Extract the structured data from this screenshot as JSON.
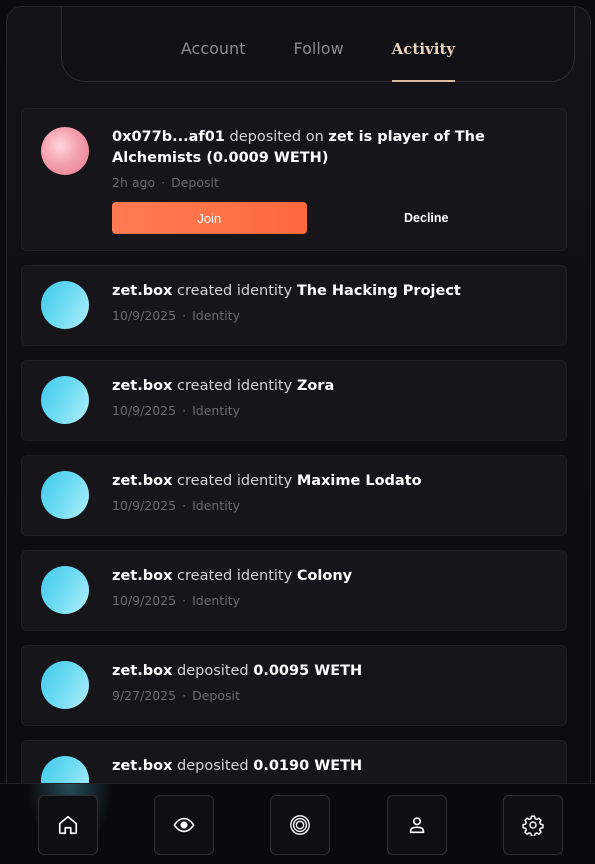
{
  "tabs": [
    {
      "label": "Account"
    },
    {
      "label": "Follow"
    },
    {
      "label": "Activity"
    }
  ],
  "feed": [
    {
      "actor": "0x077b...af01",
      "verb": "deposited on",
      "target": "zet is player of The Alchemists (0.0009 WETH)",
      "time": "2h ago",
      "kind": "Deposit",
      "join_label": "Join",
      "decline_label": "Decline"
    },
    {
      "actor": "zet.box",
      "verb": "created identity",
      "target": "The Hacking Project",
      "time": "10/9/2025",
      "kind": "Identity"
    },
    {
      "actor": "zet.box",
      "verb": "created identity",
      "target": "Zora",
      "time": "10/9/2025",
      "kind": "Identity"
    },
    {
      "actor": "zet.box",
      "verb": "created identity",
      "target": "Maxime Lodato",
      "time": "10/9/2025",
      "kind": "Identity"
    },
    {
      "actor": "zet.box",
      "verb": "created identity",
      "target": "Colony",
      "time": "10/9/2025",
      "kind": "Identity"
    },
    {
      "actor": "zet.box",
      "verb": "deposited",
      "target": "0.0095 WETH",
      "time": "9/27/2025",
      "kind": "Deposit"
    },
    {
      "actor": "zet.box",
      "verb": "deposited",
      "target": "0.0190 WETH"
    }
  ],
  "nav": [
    {
      "icon": "home-icon"
    },
    {
      "icon": "eye-icon"
    },
    {
      "icon": "target-icon"
    },
    {
      "icon": "user-icon"
    },
    {
      "icon": "gear-icon"
    }
  ],
  "colors": {
    "accent": "#ff6a3d",
    "tab_active": "#e9d3bd",
    "avatar_cyan": "#3ec9ea"
  }
}
